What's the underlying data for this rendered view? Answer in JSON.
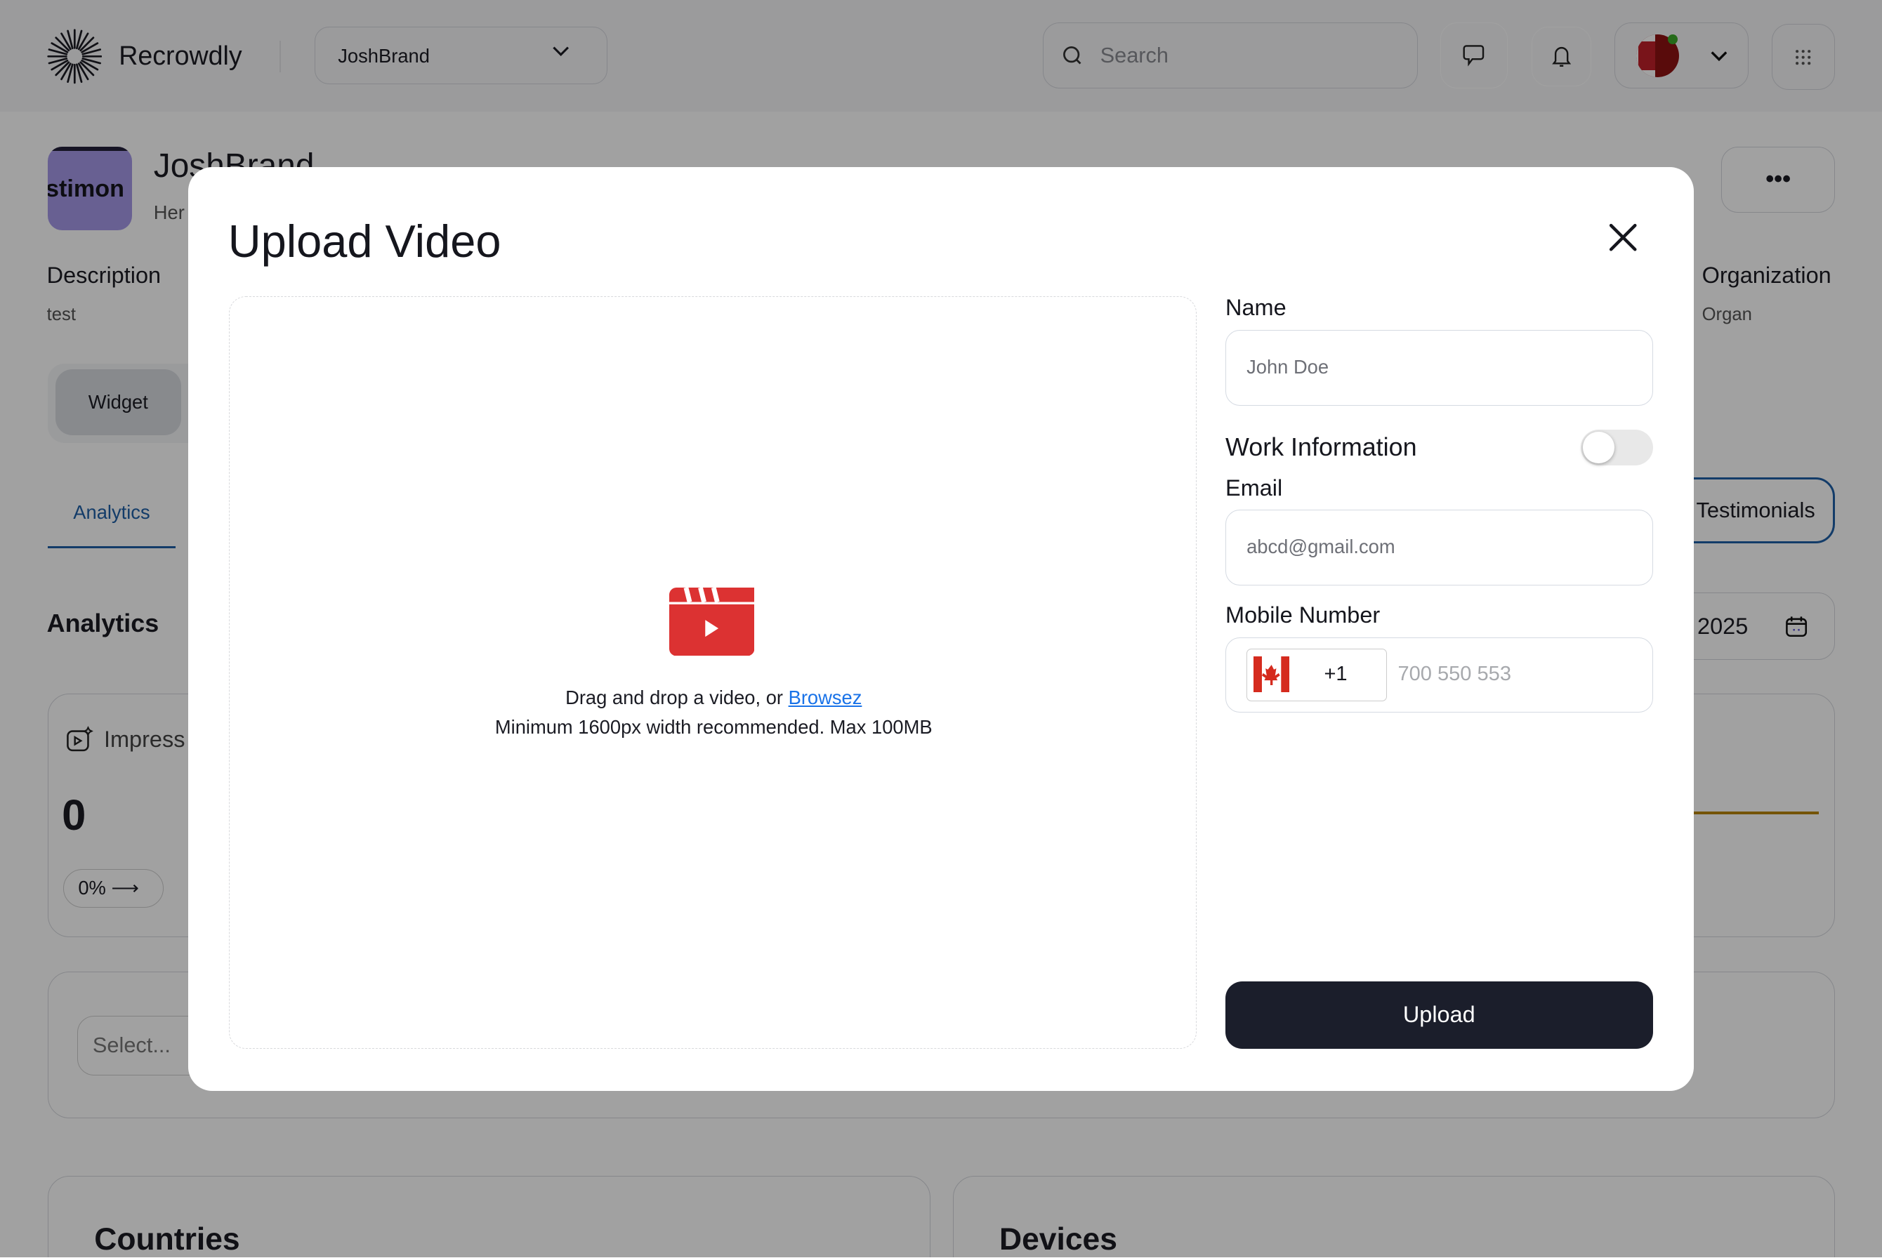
{
  "header": {
    "logo_text": "Recrowdly",
    "brand_select": "JoshBrand",
    "search_placeholder": "Search",
    "icons": [
      "sunburst-logo-icon",
      "chevron-down-icon",
      "search-icon",
      "chat-icon",
      "bell-icon",
      "avatar",
      "apps-grid-icon"
    ]
  },
  "background": {
    "brand_name": "JoshBrand",
    "brand_subtitle": "Her",
    "brand_logo_text": "stimon",
    "description_label": "Description",
    "description_value": "test",
    "organization_label": "Organization",
    "organization_value": "Organ",
    "widget_button": "Widget",
    "tab_analytics": "Analytics",
    "tab_testimonials": "Testimonials",
    "section_title": "Analytics",
    "date_fragment": "2025",
    "impressions_label": "Impress",
    "impressions_value": "0",
    "impressions_change": "0%",
    "select_placeholder": "Select...",
    "countries_title": "Countries",
    "devices_title": "Devices",
    "accent_color": "#1f5fa6",
    "line_color": "#b8860b"
  },
  "modal": {
    "title": "Upload Video",
    "dropzone": {
      "text": "Drag and drop a video, or ",
      "link": "Browsez",
      "hint": "Minimum 1600px width recommended. Max 100MB",
      "icon_color": "#dc3232"
    },
    "name_label": "Name",
    "name_placeholder": "John Doe",
    "work_info_label": "Work Information",
    "work_info_enabled": false,
    "email_label": "Email",
    "email_placeholder": "abcd@gmail.com",
    "mobile_label": "Mobile Number",
    "country_code": "+1",
    "country_flag": "canada-flag",
    "mobile_placeholder": "700 550 553",
    "upload_button": "Upload"
  }
}
